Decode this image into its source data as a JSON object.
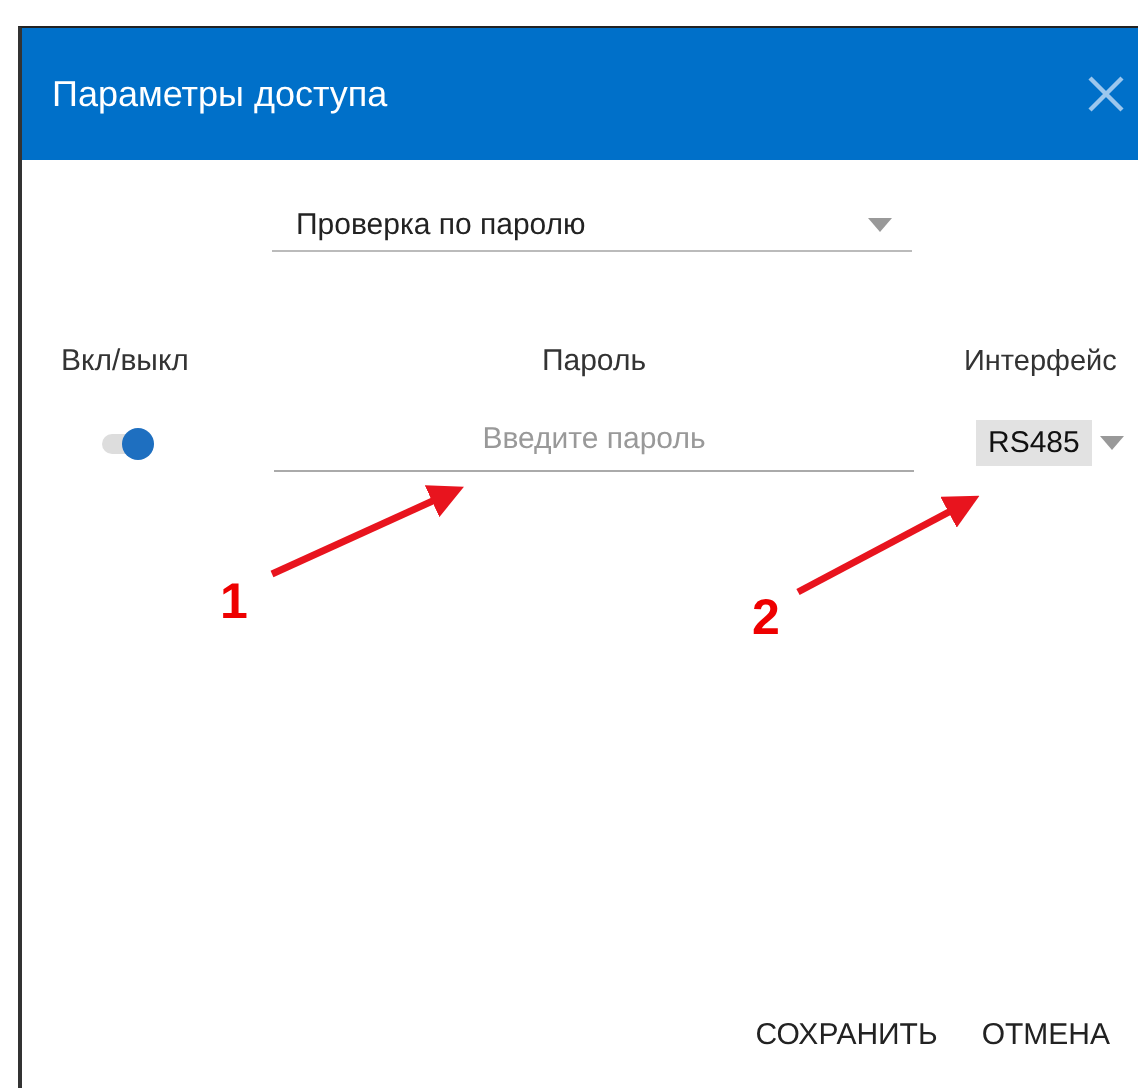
{
  "dialog": {
    "title": "Параметры доступа"
  },
  "mode_dropdown": {
    "value": "Проверка по паролю"
  },
  "columns": [
    "Вкл/выкл",
    "Пароль",
    "Интерфейс"
  ],
  "row": {
    "on": true,
    "password": {
      "placeholder": "Введите пароль"
    },
    "interface": "RS485"
  },
  "buttons": [
    "СОХРАНИТЬ",
    "ОТМЕНА"
  ],
  "annotations": [
    {
      "label": "1"
    },
    {
      "label": "2"
    }
  ]
}
